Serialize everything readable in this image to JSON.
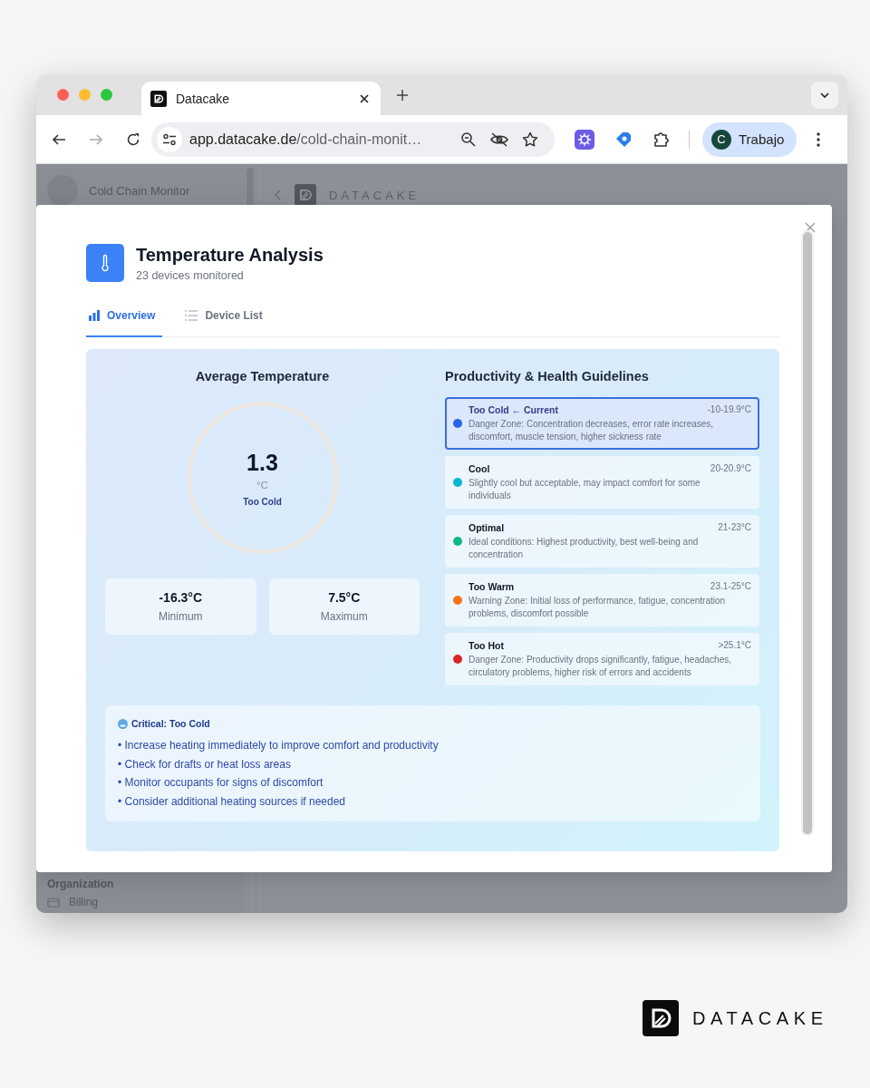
{
  "browser": {
    "tab": {
      "title": "Datacake"
    },
    "url_host": "app.datacake.de",
    "url_path": "/cold-chain-monit…",
    "profile": {
      "initial": "C",
      "name": "Trabajo"
    }
  },
  "background_app": {
    "sidebar": {
      "title": "Cold Chain Monitor",
      "items": [
        "Organization",
        "Billing"
      ]
    },
    "header": {
      "logo_text": "DATACAKE"
    }
  },
  "modal": {
    "title": "Temperature Analysis",
    "subtitle": "23 devices monitored",
    "tabs": [
      {
        "label": "Overview",
        "kind": "chart",
        "selected": true
      },
      {
        "label": "Device List",
        "kind": "list",
        "selected": false
      }
    ],
    "average": {
      "heading": "Average Temperature",
      "value": "1.3",
      "unit": "°C",
      "status": "Too Cold",
      "stats": [
        {
          "value": "-16.3°C",
          "label": "Minimum"
        },
        {
          "value": "7.5°C",
          "label": "Maximum"
        }
      ]
    },
    "guidelines": {
      "heading": "Productivity & Health Guidelines",
      "items": [
        {
          "name": "Too Cold",
          "note": "← Current",
          "range": "-10-19.9°C",
          "description": "Danger Zone: Concentration decreases, error rate increases, discomfort, muscle tension, higher sickness rate",
          "color": "#2563eb",
          "selected": true
        },
        {
          "name": "Cool",
          "range": "20-20.9°C",
          "description": "Slightly cool but acceptable, may impact comfort for some individuals",
          "color": "#06b6d4",
          "selected": false
        },
        {
          "name": "Optimal",
          "range": "21-23°C",
          "description": "Ideal conditions: Highest productivity, best well-being and concentration",
          "color": "#10b981",
          "selected": false
        },
        {
          "name": "Too Warm",
          "range": "23.1-25°C",
          "description": "Warning Zone: Initial loss of performance, fatigue, concentration problems, discomfort possible",
          "color": "#f97316",
          "selected": false
        },
        {
          "name": "Too Hot",
          "range": ">25.1°C",
          "description": "Danger Zone: Productivity drops significantly, fatigue, headaches, circulatory problems, higher risk of errors and accidents",
          "color": "#dc2626",
          "selected": false
        }
      ]
    },
    "alert": {
      "title": "Critical: Too Cold",
      "items": [
        "• Increase heating immediately to improve comfort and productivity",
        "• Check for drafts or heat loss areas",
        "• Monitor occupants for signs of discomfort",
        "• Consider additional heating sources if needed"
      ]
    }
  },
  "brand": {
    "logo_text": "DATACAKE"
  }
}
